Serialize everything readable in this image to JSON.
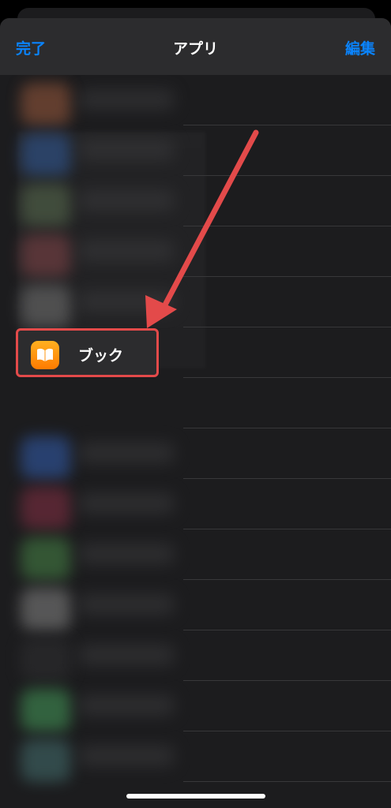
{
  "nav": {
    "done_label": "完了",
    "title": "アプリ",
    "edit_label": "編集"
  },
  "highlighted_app": {
    "label": "ブック",
    "icon": "book-icon"
  },
  "colors": {
    "accent": "#0a84ff",
    "highlight": "#e34a4a",
    "background": "#1c1c1e",
    "book_icon": "#ff9500"
  },
  "blurred_icon_colors": [
    "#7a4a35",
    "#2e4d7d",
    "#4b5a44",
    "#6a3c3f",
    "#5e5e5e",
    "#2d4d8a",
    "#6a2a3a",
    "#3c6a3c",
    "#6a6a6a",
    "#2a2a2c",
    "#3a7a4a",
    "#3a5a5a",
    "#4a4a4a"
  ]
}
